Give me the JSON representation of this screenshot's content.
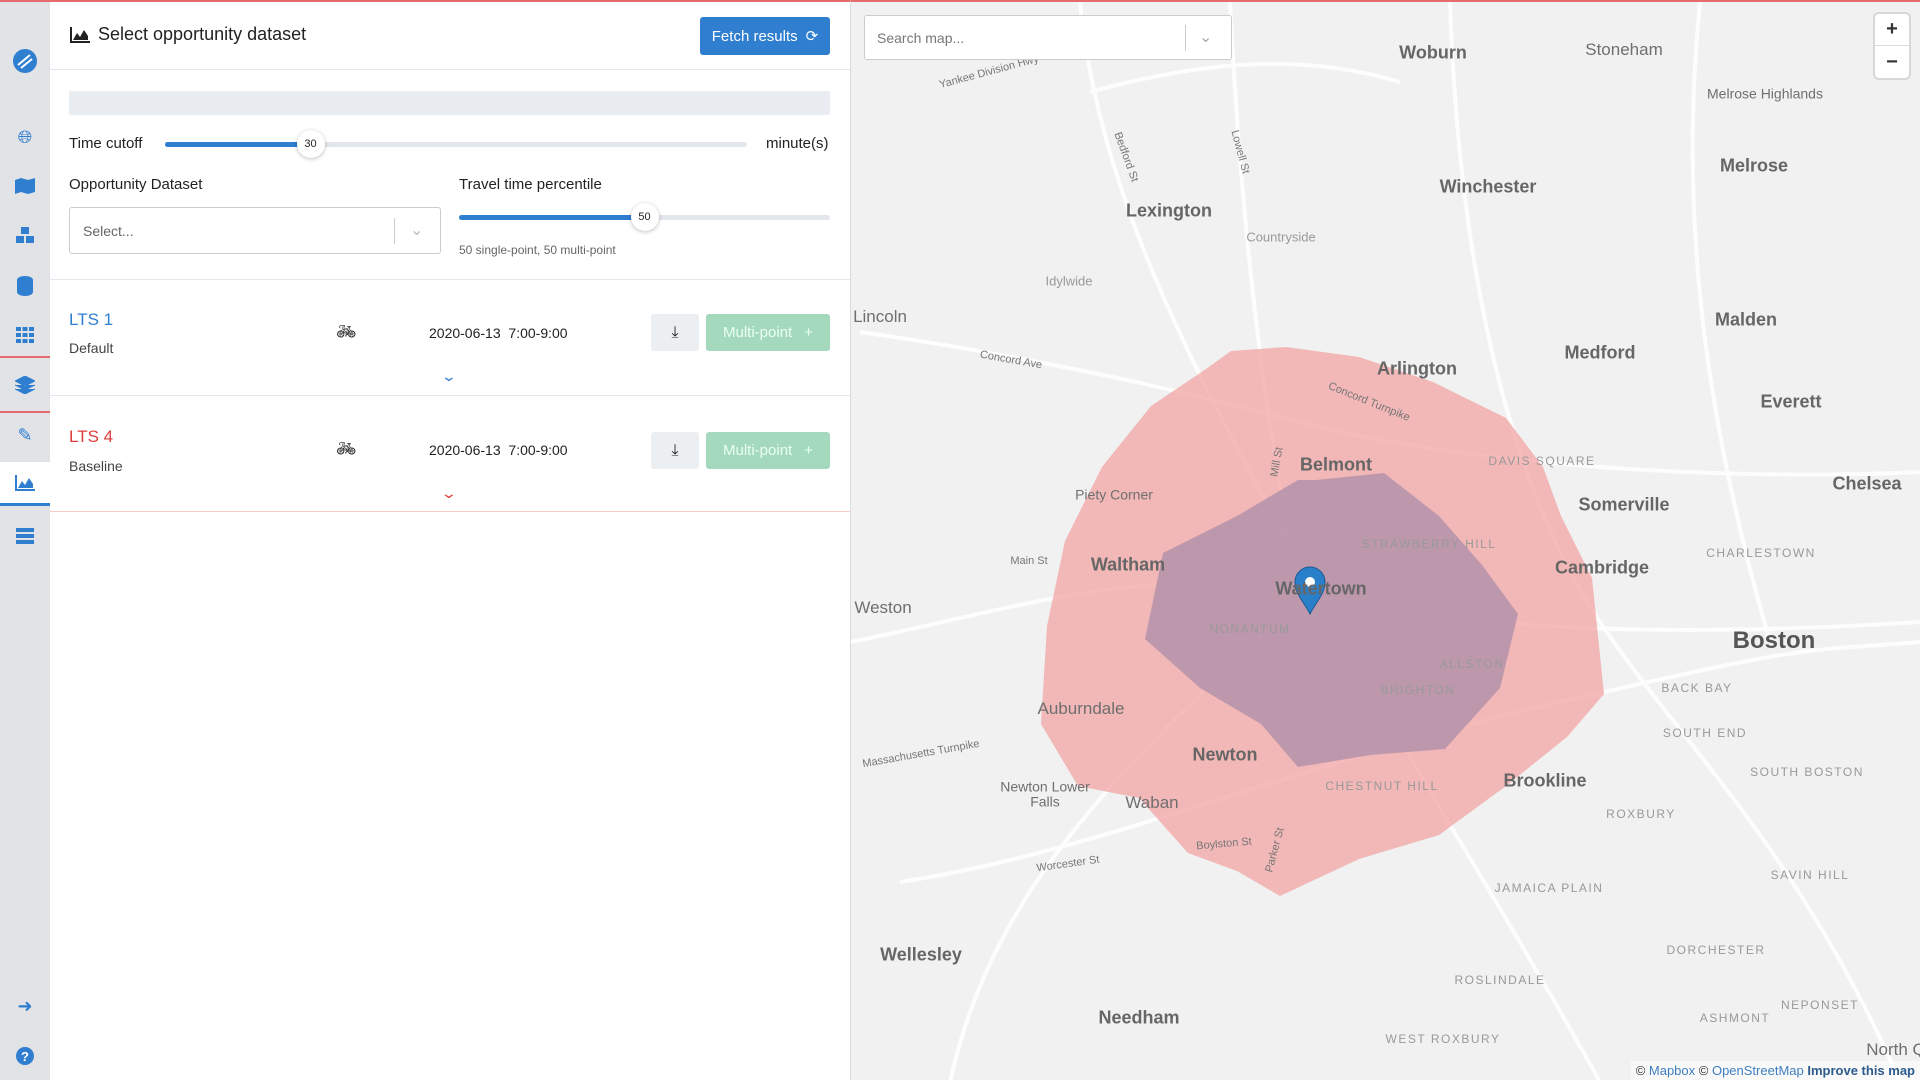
{
  "sidebar": {
    "items": [
      "logo",
      "globe",
      "map",
      "modifications",
      "database",
      "grid",
      "layers",
      "edit",
      "analysis",
      "regional"
    ],
    "active": "analysis",
    "bottom": [
      "sign-out",
      "help"
    ]
  },
  "header": {
    "title": "Select opportunity dataset",
    "fetch_label": "Fetch results"
  },
  "time_cutoff": {
    "label": "Time cutoff",
    "value": 30,
    "min": 0,
    "max": 120,
    "unit": "minute(s)",
    "value_text": "30"
  },
  "opportunity": {
    "label": "Opportunity Dataset",
    "placeholder": "Select..."
  },
  "percentile": {
    "label": "Travel time percentile",
    "value": 50,
    "min": 1,
    "max": 99,
    "value_text": "50",
    "note": "50 single-point, 50 multi-point"
  },
  "scenarios": [
    {
      "title": "LTS 1",
      "subtitle": "Default",
      "color": "#2f7ed0",
      "mode_icon": "bicycle-icon",
      "date": "2020-06-13",
      "time": "7:00-9:00",
      "multipoint_label": "Multi-point"
    },
    {
      "title": "LTS 4",
      "subtitle": "Baseline",
      "color": "#e03b3b",
      "mode_icon": "bicycle-icon",
      "date": "2020-06-13",
      "time": "7:00-9:00",
      "multipoint_label": "Multi-point"
    }
  ],
  "map": {
    "search_placeholder": "Search map...",
    "zoom_in": "+",
    "zoom_out": "−",
    "attribution": {
      "mapbox": "Mapbox",
      "osm": "OpenStreetMap",
      "improve": "Improve this map"
    },
    "isochrone_colors": {
      "lts4": "#f2a3a3",
      "lts1": "#a78aa8"
    },
    "labels": [
      "Woburn",
      "Stoneham",
      "Melrose Highlands",
      "Melrose",
      "Winchester",
      "Lexington",
      "Countryside",
      "Idylwide",
      "Lincoln",
      "Malden",
      "Medford",
      "Arlington",
      "Everett",
      "Belmont",
      "DAVIS SQUARE",
      "Somerville",
      "Chelsea",
      "Piety Corner",
      "STRAWBERRY HILL",
      "CHARLESTOWN",
      "Waltham",
      "Watertown",
      "Cambridge",
      "Weston",
      "NONANTUM",
      "Boston",
      "ALLSTON",
      "BRIGHTON",
      "BACK BAY",
      "Auburndale",
      "SOUTH END",
      "Newton",
      "CHESTNUT HILL",
      "Brookline",
      "SOUTH BOSTON",
      "Newton Lower Falls",
      "Waban",
      "ROXBURY",
      "JAMAICA PLAIN",
      "SAVIN HILL",
      "DORCHESTER",
      "Wellesley",
      "ROSLINDALE",
      "Needham",
      "ASHMONT",
      "NEPONSET",
      "WEST ROXBURY",
      "North Q",
      "Concord Ave",
      "Concord Turnpike",
      "Main St",
      "Mill St",
      "Massachusetts Turnpike",
      "Worcester St",
      "Boylston St",
      "Parker St",
      "Yankee Division Hwy",
      "Bedford St",
      "Lowell St"
    ]
  }
}
